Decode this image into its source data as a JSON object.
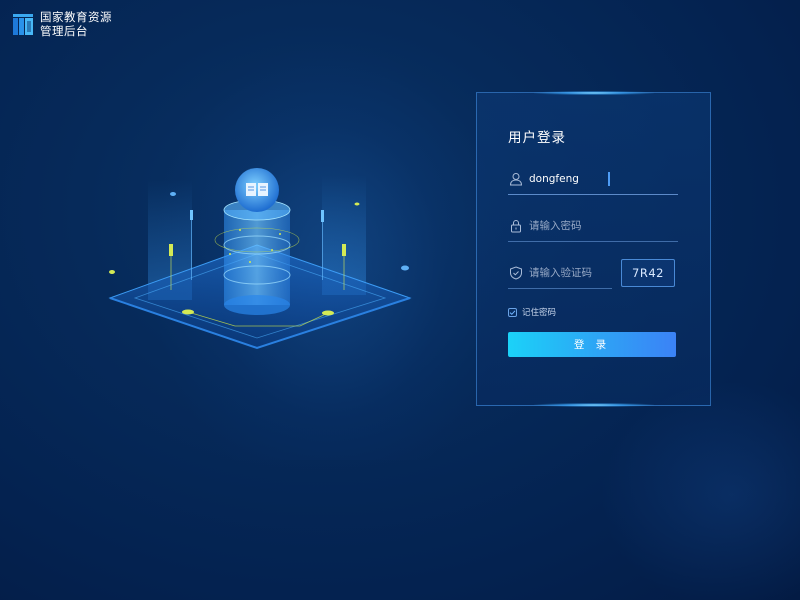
{
  "header": {
    "title_line1": "国家教育资源",
    "title_line2": "管理后台",
    "logo_icon": "book-stack-logo-icon"
  },
  "login": {
    "title": "用户登录",
    "username": {
      "value": "dongfeng",
      "icon": "user-icon"
    },
    "password": {
      "placeholder": "请输入密码",
      "icon": "lock-icon"
    },
    "captcha": {
      "placeholder": "请输入验证码",
      "icon": "shield-check-icon",
      "code": "7R42"
    },
    "remember": {
      "label": "记住密码",
      "checked": true
    },
    "submit_label": "登 录"
  },
  "colors": {
    "background": "#042250",
    "accent": "#2ea3f5",
    "button_start": "#1bd2f8",
    "button_end": "#3b82f6",
    "border": "#4696eb"
  }
}
